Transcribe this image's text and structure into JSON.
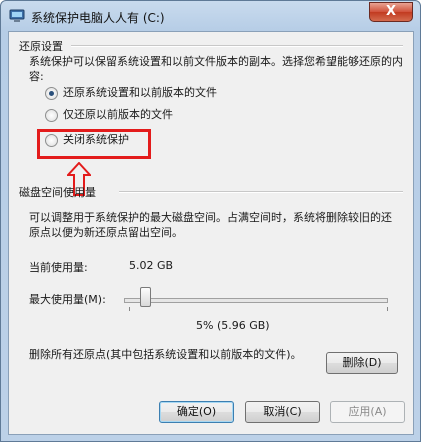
{
  "window": {
    "title": "系统保护电脑人人有 (C:)",
    "close_label": "X"
  },
  "restore_settings": {
    "group_label": "还原设置",
    "description": "系统保护可以保留系统设置和以前文件版本的副本。选择您希望能够还原的内容:",
    "options": [
      {
        "label": "还原系统设置和以前版本的文件",
        "checked": true
      },
      {
        "label": "仅还原以前版本的文件",
        "checked": false
      },
      {
        "label": "关闭系统保护",
        "checked": false
      }
    ]
  },
  "disk_usage": {
    "group_label": "磁盘空间使用量",
    "description": "可以调整用于系统保护的最大磁盘空间。占满空间时，系统将删除较旧的还原点以便为新还原点留出空间。",
    "current_label": "当前使用量:",
    "current_value": "5.02 GB",
    "max_label": "最大使用量(M):",
    "slider_value_text": "5% (5.96 GB)",
    "slider_percent": 5,
    "delete_text": "删除所有还原点(其中包括系统设置和以前版本的文件)。",
    "delete_button": "删除(D)"
  },
  "footer": {
    "ok_button": "确定(O)",
    "cancel_button": "取消(C)",
    "apply_button": "应用(A)"
  },
  "annotation": {
    "highlight_color": "#e31b1b"
  }
}
